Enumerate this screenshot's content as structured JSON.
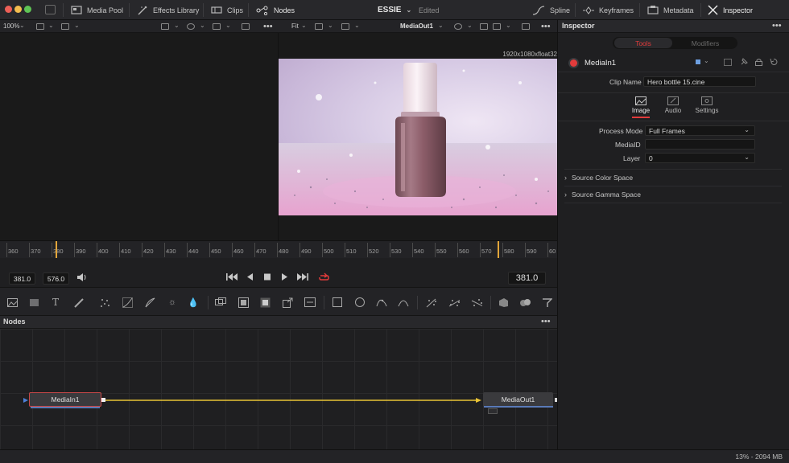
{
  "topbar": {
    "media_pool": "Media Pool",
    "effects_library": "Effects Library",
    "clips": "Clips",
    "nodes": "Nodes",
    "project": "ESSIE",
    "project_status": "Edited",
    "spline": "Spline",
    "keyframes": "Keyframes",
    "metadata": "Metadata",
    "inspector": "Inspector"
  },
  "viewer": {
    "left_zoom": "100%",
    "right_zoom": "Fit",
    "right_node": "MediaOut1",
    "resolution": "1920x1080xfloat32"
  },
  "ruler": {
    "ticks": [
      "360",
      "370",
      "380",
      "390",
      "400",
      "410",
      "420",
      "430",
      "440",
      "450",
      "460",
      "470",
      "480",
      "490",
      "500",
      "510",
      "520",
      "530",
      "540",
      "550",
      "560",
      "570",
      "580",
      "590",
      "60"
    ]
  },
  "transport": {
    "start": "381.0",
    "end": "576.0",
    "current": "381.0"
  },
  "nodes": {
    "title": "Nodes",
    "node_in": "MediaIn1",
    "node_out": "MediaOut1"
  },
  "status": {
    "memory": "13% - 2094 MB"
  },
  "inspector": {
    "title": "Inspector",
    "tab_tools": "Tools",
    "tab_modifiers": "Modifiers",
    "node_name": "MediaIn1",
    "clip_name_label": "Clip Name",
    "clip_name_value": "Hero bottle 15.cine",
    "subtab_image": "Image",
    "subtab_audio": "Audio",
    "subtab_settings": "Settings",
    "process_mode_label": "Process Mode",
    "process_mode_value": "Full Frames",
    "mediaid_label": "MediaID",
    "mediaid_value": "",
    "layer_label": "Layer",
    "layer_value": "0",
    "section_color": "Source Color Space",
    "section_gamma": "Source Gamma Space"
  },
  "colors": {
    "accent_red": "#e23b3b",
    "connection": "#e9c336",
    "tools_tab": "#e23b3b"
  }
}
